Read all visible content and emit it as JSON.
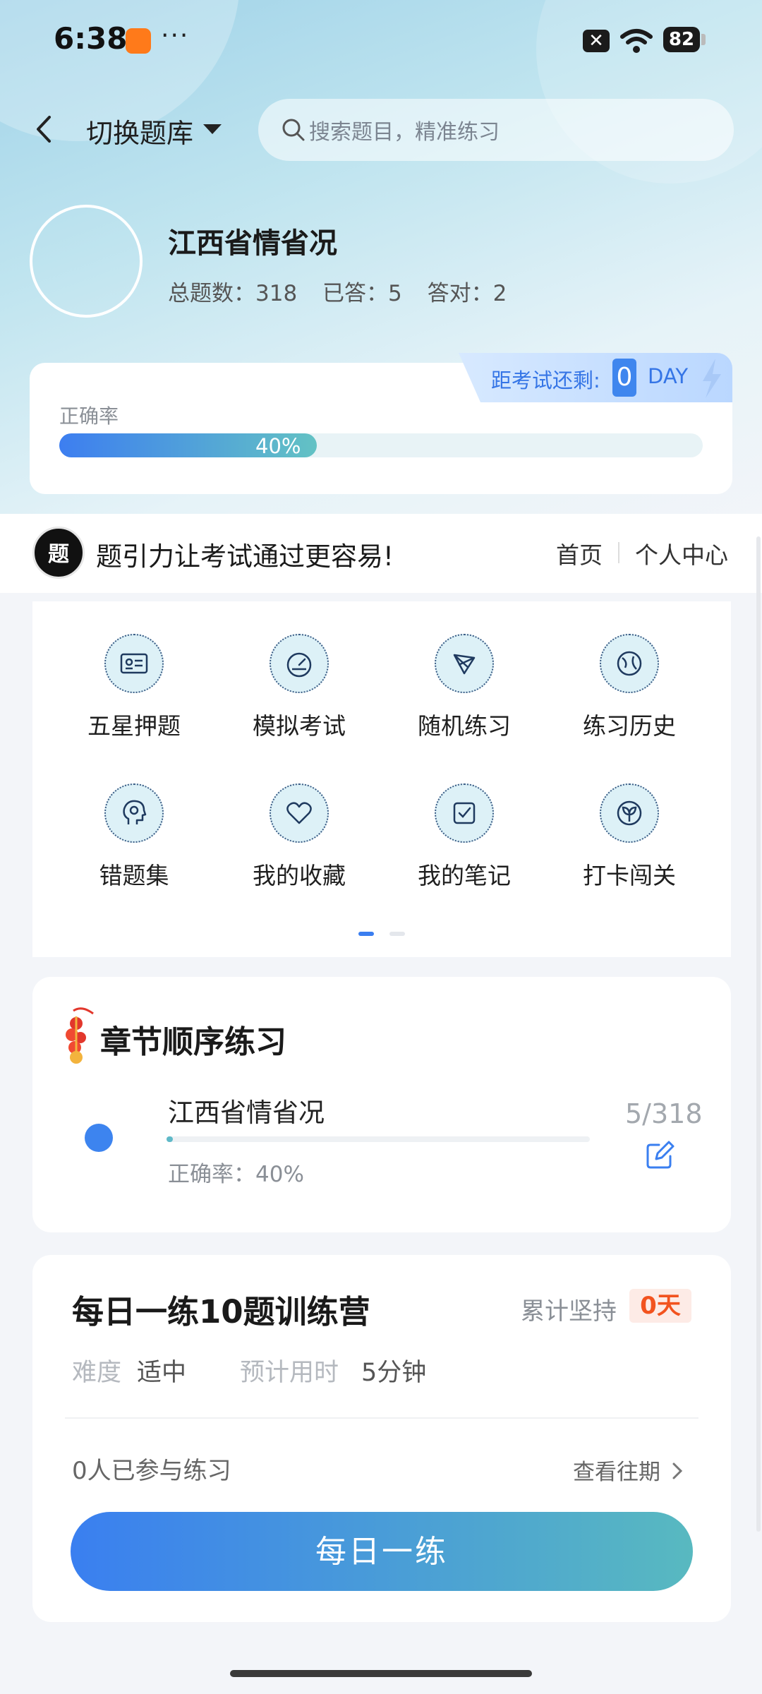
{
  "status_bar": {
    "time": "6:38",
    "dots": "···",
    "battery": "82"
  },
  "topbar": {
    "switch_label": "切换题库",
    "search_placeholder": "搜索题目，精准练习"
  },
  "profile": {
    "title": "江西省情省况",
    "stats": [
      {
        "label": "总题数：",
        "value": "318"
      },
      {
        "label": "已答：",
        "value": "5"
      },
      {
        "label": "答对：",
        "value": "2"
      }
    ]
  },
  "countdown": {
    "label": "距考试还剩:",
    "days": "0",
    "unit": "DAY"
  },
  "accuracy": {
    "label": "正确率",
    "text": "40%",
    "fraction": 0.4
  },
  "brand": {
    "logo": "题",
    "slogan": "题引力让考试通过更容易!",
    "home": "首页",
    "me": "个人中心"
  },
  "tools": [
    {
      "label": "五星押题",
      "icon": "id-card-icon"
    },
    {
      "label": "模拟考试",
      "icon": "speedometer-icon"
    },
    {
      "label": "随机练习",
      "icon": "shuffle-icon"
    },
    {
      "label": "练习历史",
      "icon": "globe-icon"
    },
    {
      "label": "错题集",
      "icon": "head-icon"
    },
    {
      "label": "我的收藏",
      "icon": "heart-icon"
    },
    {
      "label": "我的笔记",
      "icon": "note-check-icon"
    },
    {
      "label": "打卡闯关",
      "icon": "sprout-icon"
    }
  ],
  "chapter": {
    "title": "章节顺序练习",
    "item_name": "江西省情省况",
    "accuracy": "正确率：40%",
    "count": "5/318",
    "progress_fraction": 0.0157
  },
  "daily": {
    "title": "每日一练10题训练营",
    "persist_label": "累计坚持",
    "persist_value": "0天",
    "difficulty_label": "难度",
    "difficulty_value": "适中",
    "time_label": "预计用时",
    "time_value": "5分钟",
    "participants": "0人已参与练习",
    "history_link": "查看往期",
    "button": "每日一练"
  },
  "colors": {
    "accent": "#3a7ff0",
    "teal": "#58b9c0",
    "orange": "#f2531f"
  }
}
